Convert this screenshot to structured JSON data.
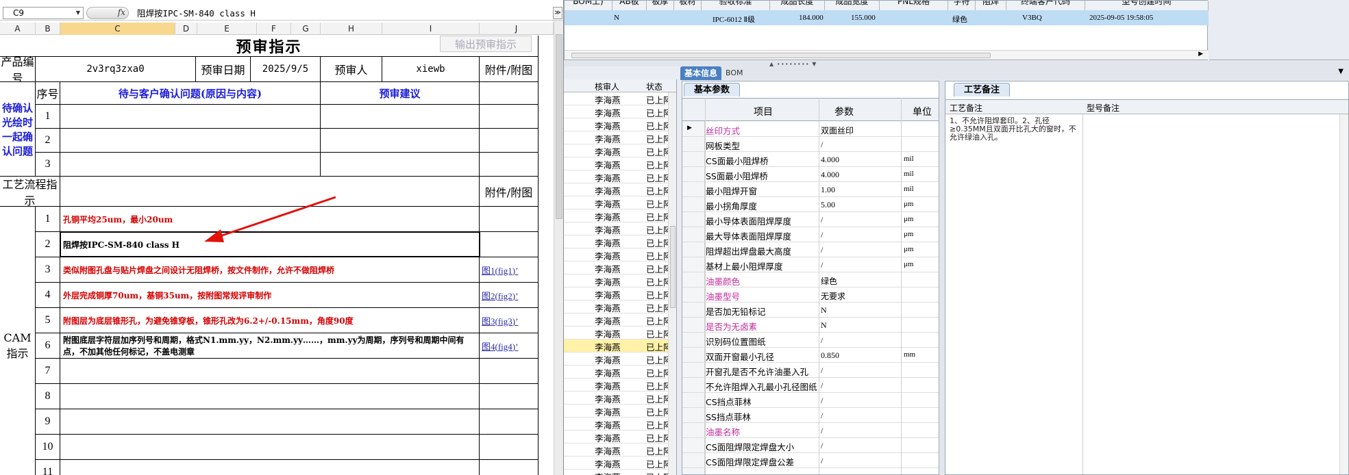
{
  "excel": {
    "name_box": "C9",
    "formula": "阻焊按IPC-SM-840 class H",
    "columns": [
      "A",
      "B",
      "C",
      "D",
      "E",
      "F",
      "G",
      "H",
      "I",
      "J"
    ],
    "title": "预审指示",
    "export_button": "输出预审指示",
    "product_no_label": "产品编号",
    "product_no": "2v3rq3zxa0",
    "date_label": "预审日期",
    "date": "2025/9/5",
    "reviewer_label": "预审人",
    "reviewer": "xiewb",
    "attach_label": "附件/附图",
    "seq_label": "序号",
    "confirm_header": "待与客户确认问题(原因与内容)",
    "suggest_header": "预审建议",
    "confirm_group_label": "待确认光绘时一起确认问题",
    "confirm_rows": [
      "1",
      "2",
      "3"
    ],
    "flow_label": "工艺流程指示",
    "cam_label": "CAM指示",
    "cam_rows": [
      {
        "n": "1",
        "text": "孔铜平均25um，最小20um",
        "style": "red",
        "attach": ""
      },
      {
        "n": "2",
        "text": "阻焊按IPC-SM-840 class H",
        "style": "blk",
        "attach": ""
      },
      {
        "n": "3",
        "text": "类似附图孔盘与贴片焊盘之间设计无阻焊桥，按文件制作，允许不做阻焊桥",
        "style": "red",
        "attach": "图1(fig1)’"
      },
      {
        "n": "4",
        "text": "外层完成铜厚70um，基铜35um，按附图常规评审制作",
        "style": "red",
        "attach": "图2(fig2)’"
      },
      {
        "n": "5",
        "text": "附图层为底层锥形孔，为避免锥穿板，锥形孔改为6.2+/-0.15mm，角度90度",
        "style": "red",
        "attach": "图3(fig3)’"
      },
      {
        "n": "6",
        "text": "附图底层字符层加序列号和周期，格式N1.mm.yy，N2.mm.yy……，mm.yy为周期，序列号和周期中间有点，不加其他任何标记，不盖电测章",
        "style": "blk",
        "attach": "图4(fig4)’"
      },
      {
        "n": "7",
        "text": "",
        "style": "blk",
        "attach": ""
      },
      {
        "n": "8",
        "text": "",
        "style": "blk",
        "attach": ""
      },
      {
        "n": "9",
        "text": "",
        "style": "blk",
        "attach": ""
      },
      {
        "n": "10",
        "text": "",
        "style": "blk",
        "attach": ""
      },
      {
        "n": "11",
        "text": "",
        "style": "blk",
        "attach": ""
      }
    ]
  },
  "app": {
    "top_headers": [
      "BOM工)",
      "AB板",
      "板厚",
      "板材",
      "验收标准",
      "成品长度",
      "成品宽度",
      "PNL规格",
      "字符",
      "阻焊",
      "终端客户代码",
      "型号创建时间"
    ],
    "top_row": {
      "ab": "N",
      "standard": "IPC-6012 Ⅱ级",
      "length": "184.000",
      "width": "155.000",
      "mask_color": "绿色",
      "customer_code": "V3BQ",
      "created": "2025-09-05 19:58:05"
    },
    "tabs": [
      "基本信息",
      "BOM"
    ],
    "audit_headers": {
      "reviewer": "核审人",
      "status": "状态"
    },
    "audit_reviewer": "李海燕",
    "audit_status": "已上阿",
    "audit_row_count": 30,
    "audit_highlight_index": 19,
    "params_tab": "基本参数",
    "params_headers": {
      "item": "项目",
      "param": "参数",
      "unit": "单位"
    },
    "params": [
      {
        "name": "丝印方式",
        "value": "双面丝印",
        "unit": "",
        "pink": true,
        "cur": true
      },
      {
        "name": "网板类型",
        "value": "/",
        "unit": "",
        "pink": false
      },
      {
        "name": "CS面最小阻焊桥",
        "value": "4.000",
        "unit": "mil",
        "pink": false
      },
      {
        "name": "SS面最小阻焊桥",
        "value": "4.000",
        "unit": "mil",
        "pink": false
      },
      {
        "name": "最小阻焊开窗",
        "value": "1.00",
        "unit": "mil",
        "pink": false
      },
      {
        "name": "最小拐角厚度",
        "value": "5.00",
        "unit": "μm",
        "pink": false
      },
      {
        "name": "最小导体表面阻焊厚度",
        "value": "/",
        "unit": "μm",
        "pink": false
      },
      {
        "name": "最大导体表面阻焊厚度",
        "value": "/",
        "unit": "μm",
        "pink": false
      },
      {
        "name": "阻焊超出焊盘最大高度",
        "value": "/",
        "unit": "μm",
        "pink": false
      },
      {
        "name": "基材上最小阻焊厚度",
        "value": "/",
        "unit": "μm",
        "pink": false
      },
      {
        "name": "油墨颜色",
        "value": "绿色",
        "unit": "",
        "pink": true
      },
      {
        "name": "油墨型号",
        "value": "无要求",
        "unit": "",
        "pink": true
      },
      {
        "name": "是否加无铅标记",
        "value": "N",
        "unit": "",
        "pink": false
      },
      {
        "name": "是否为无卤素",
        "value": "N",
        "unit": "",
        "pink": true
      },
      {
        "name": "识别码位置图纸",
        "value": "/",
        "unit": "",
        "pink": false
      },
      {
        "name": "双面开窗最小孔径",
        "value": "0.850",
        "unit": "mm",
        "pink": false
      },
      {
        "name": "开窗孔是否不允许油墨入孔",
        "value": "/",
        "unit": "",
        "pink": false
      },
      {
        "name": "不允许阻焊入孔最小孔径图纸",
        "value": "/",
        "unit": "",
        "pink": false
      },
      {
        "name": "CS挡点菲林",
        "value": "/",
        "unit": "",
        "pink": false
      },
      {
        "name": "SS挡点菲林",
        "value": "/",
        "unit": "",
        "pink": false
      },
      {
        "name": "油墨名称",
        "value": "/",
        "unit": "",
        "pink": true
      },
      {
        "name": "CS面阻焊限定焊盘大小",
        "value": "/",
        "unit": "",
        "pink": false
      },
      {
        "name": "CS面阻焊限定焊盘公差",
        "value": "/",
        "unit": "",
        "pink": false
      }
    ],
    "remarks_tab": "工艺备注",
    "remarks_headers": {
      "process": "工艺备注",
      "model": "型号备注"
    },
    "remark_text": "1、不允许阻焊套印。2、孔径≥0.35MM且双面开比孔大的窗时，不允许绿油入孔。"
  }
}
